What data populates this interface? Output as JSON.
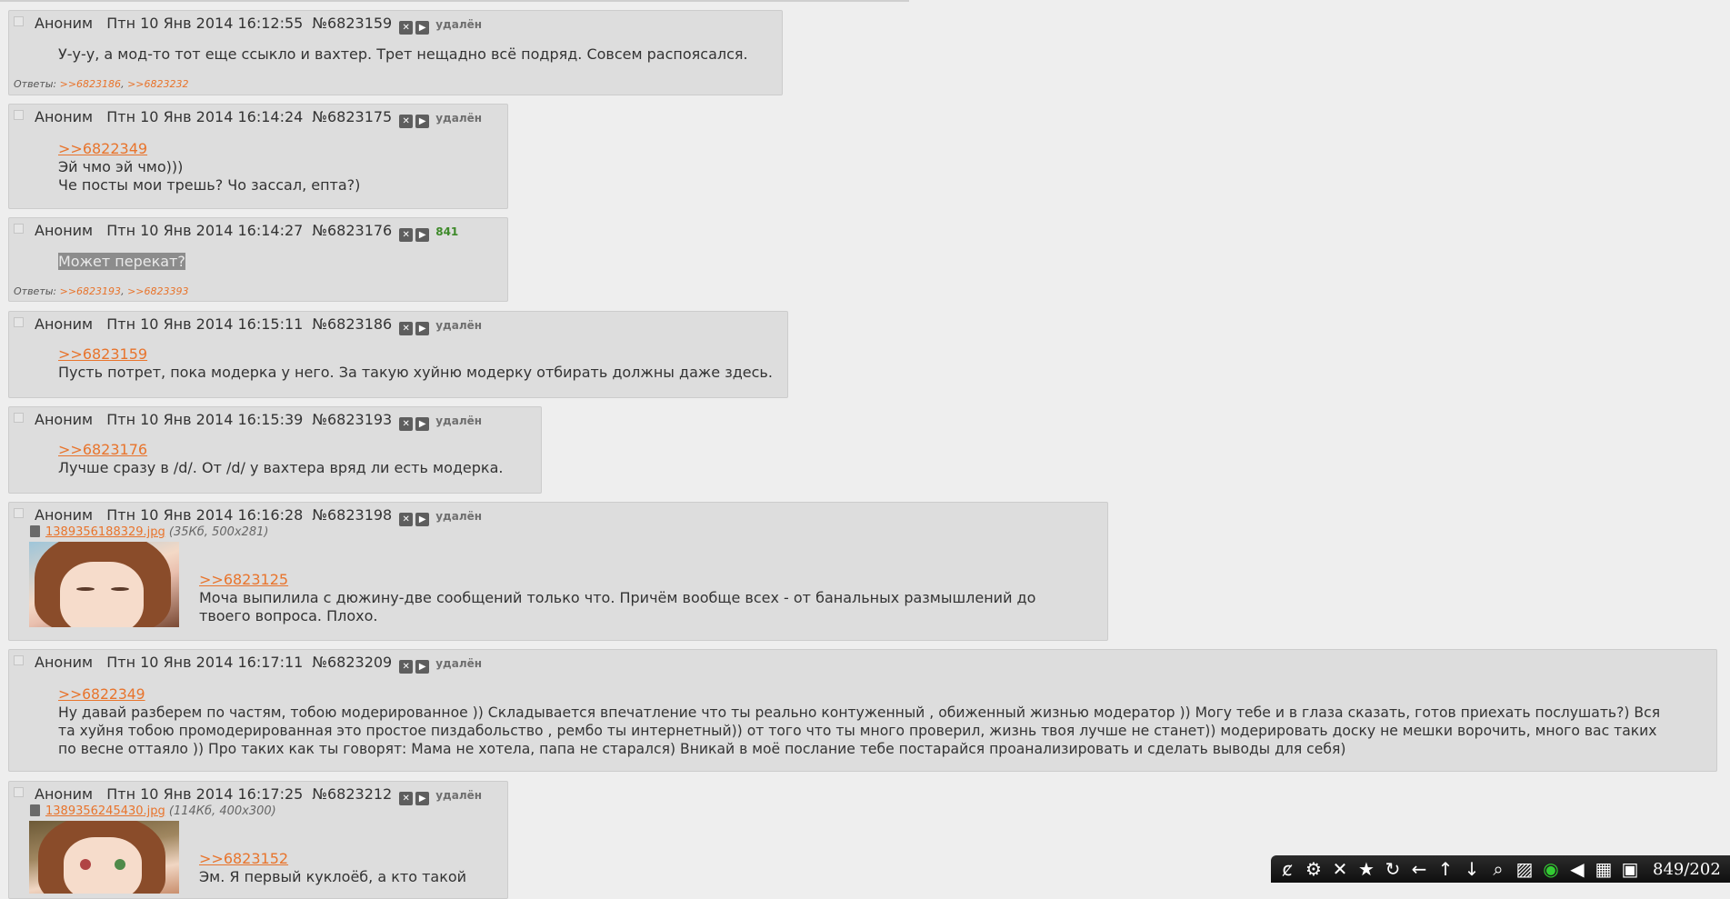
{
  "colors": {
    "link": "#e8742c",
    "post_bg": "#dddddd",
    "page_bg": "#eeeeee",
    "toolbar_bg": "#111111",
    "green_status": "#3e8a2a"
  },
  "posts": [
    {
      "author": "Аноним",
      "date": "Птн 10 Янв 2014 16:12:55",
      "number": "№6823159",
      "status": "удалён",
      "lines": [
        "У-у-у, а мод-то тот еще ссыкло и вахтер. Трет нещадно всё подряд. Совсем распоясался."
      ],
      "replies_label": "Ответы:",
      "replies": [
        ">>6823186",
        ">>6823232"
      ]
    },
    {
      "author": "Аноним",
      "date": "Птн 10 Янв 2014 16:14:24",
      "number": "№6823175",
      "status": "удалён",
      "quote": ">>6822349",
      "lines": [
        "Эй чмо эй чмо)))",
        "Че посты мои трешь? Чо зассал, епта?)"
      ]
    },
    {
      "author": "Аноним",
      "date": "Птн 10 Янв 2014 16:14:27",
      "number": "№6823176",
      "status": "841",
      "lines": [
        "Может перекат?"
      ],
      "replies_label": "Ответы:",
      "replies": [
        ">>6823193",
        ">>6823393"
      ]
    },
    {
      "author": "Аноним",
      "date": "Птн 10 Янв 2014 16:15:11",
      "number": "№6823186",
      "status": "удалён",
      "quote": ">>6823159",
      "lines": [
        "Пусть потрет, пока модерка у него. За такую хуйню модерку отбирать должны даже здесь."
      ]
    },
    {
      "author": "Аноним",
      "date": "Птн 10 Янв 2014 16:15:39",
      "number": "№6823193",
      "status": "удалён",
      "quote": ">>6823176",
      "lines": [
        "Лучше сразу в /d/. От /d/ у вахтера вряд ли есть модерка."
      ]
    },
    {
      "author": "Аноним",
      "date": "Птн 10 Янв 2014 16:16:28",
      "number": "№6823198",
      "status": "удалён",
      "file": {
        "name": "1389356188329.jpg",
        "meta": "(35Кб, 500x281)"
      },
      "quote": ">>6823125",
      "lines": [
        "Моча выпилила с дюжину-две сообщений только что. Причём вообще всех - от банальных размышлений до",
        "твоего вопроса. Плохо."
      ]
    },
    {
      "author": "Аноним",
      "date": "Птн 10 Янв 2014 16:17:11",
      "number": "№6823209",
      "status": "удалён",
      "quote": ">>6822349",
      "lines": [
        "Ну давай разберем по частям, тобою модерированное )) Складывается впечатление что ты реально контуженный , обиженный жизнью модератор )) Могу тебе и в глаза сказать, готов приехать послушать?) Вся",
        "та хуйня тобою промодерированная это простое пиздабольство , рембо ты интернетный)) от того что ты много проверил, жизнь твоя лучше не станет)) модерировать доску не мешки ворочить, много вас таких",
        "по весне оттаяло )) Про таких как ты говорят: Мама не хотела, папа не старался) Вникай в моё послание тебе постарайся проанализировать и сделать выводы для себя)"
      ]
    },
    {
      "author": "Аноним",
      "date": "Птн 10 Янв 2014 16:17:25",
      "number": "№6823212",
      "status": "удалён",
      "file": {
        "name": "1389356245430.jpg",
        "meta": "(114Кб, 400x300)"
      },
      "quote": ">>6823152",
      "lines": [
        "Эм. Я первый куклоёб, а кто такой"
      ]
    }
  ],
  "toolbar": {
    "icons": [
      "dollchan-icon",
      "settings-gear-icon",
      "close-x-icon",
      "favorites-star-icon",
      "refresh-icon",
      "arrow-left-icon",
      "arrow-up-icon",
      "arrow-down-icon",
      "zoom-icon",
      "hatch-icon",
      "eye-icon",
      "mute-icon",
      "grid-icon",
      "save-icon"
    ],
    "counter": "849/202"
  }
}
